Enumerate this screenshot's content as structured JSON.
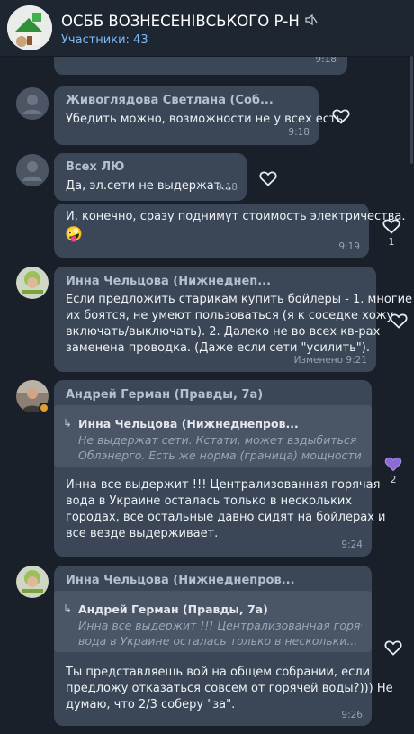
{
  "header": {
    "title": "ОСББ ВОЗНЕСЕНІВСЬКОГО Р-Н",
    "subtitle": "Участники: 43",
    "mute_icon": "muted-speaker-icon"
  },
  "messages": [
    {
      "time": "9:18"
    },
    {
      "sender": "Живоглядова Светлана (Соб...",
      "text": "Убедить можно, возможности не у всех есть",
      "time": "9:18"
    },
    {
      "sender": "Всех ЛЮ",
      "text": "Да, эл.сети не выдержат...",
      "time": "9:18"
    },
    {
      "text": "И, конечно, сразу поднимут стоимость электричества.",
      "emoji": "🤪",
      "time": "9:19",
      "reaction_count": "1"
    },
    {
      "sender": "Инна Чельцова (Нижнеднеп...",
      "lines": [
        "Если предложить старикам купить бойлеры - 1. многие",
        "их боятся, не умеют пользоваться (я к соседке хожу",
        "включать/выключать). 2. Далеко не во всех кв-рах",
        "заменена проводка. (Даже если сети \"усилить\")."
      ],
      "time": "Изменено 9:21"
    },
    {
      "sender": "Андрей Герман (Правды, 7а)",
      "quote_name": "Инна Чельцова (Нижнеднепров...",
      "quote_lines": [
        "Не выдержат сети. Кстати, может вздыбиться",
        "Облэнерго. Есть же норма (граница) мощности н..."
      ],
      "lines": [
        "Инна все выдержит !!! Централизованная горячая",
        "вода в Украине  осталась только в нескольких",
        "городах, все остальные давно сидят на бойлерах и",
        "все везде выдерживает."
      ],
      "time": "9:24",
      "reaction_count": "2"
    },
    {
      "sender": "Инна Чельцова (Нижнеднепров...",
      "quote_name": "Андрей Герман (Правды, 7а)",
      "quote_lines": [
        "Инна все выдержит !!! Централизованная горячая",
        "вода в Украине  осталась только в нескольки..."
      ],
      "lines": [
        "Ты представляешь вой на общем собрании, если",
        "предложу отказаться совсем от горячей воды?))) Не",
        "думаю, что 2/3 соберу \"за\"."
      ],
      "time": "9:26"
    }
  ],
  "colors": {
    "background": "#1a2029",
    "bubble": "#3b4656",
    "accent": "#7db8f0",
    "reaction_active": "#8b6cd6"
  }
}
